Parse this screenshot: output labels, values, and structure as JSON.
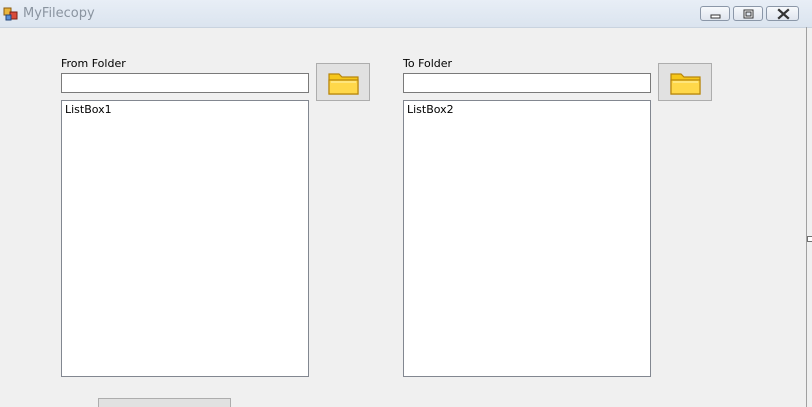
{
  "window": {
    "title": "MyFilecopy"
  },
  "from": {
    "label": "From Folder",
    "path_value": "",
    "list_item": "ListBox1",
    "browse_icon": "folder-icon"
  },
  "to": {
    "label": "To Folder",
    "path_value": "",
    "list_item": "ListBox2",
    "browse_icon": "folder-icon"
  },
  "colors": {
    "folder_fill": "#f6c619",
    "folder_edge": "#b8860b"
  }
}
